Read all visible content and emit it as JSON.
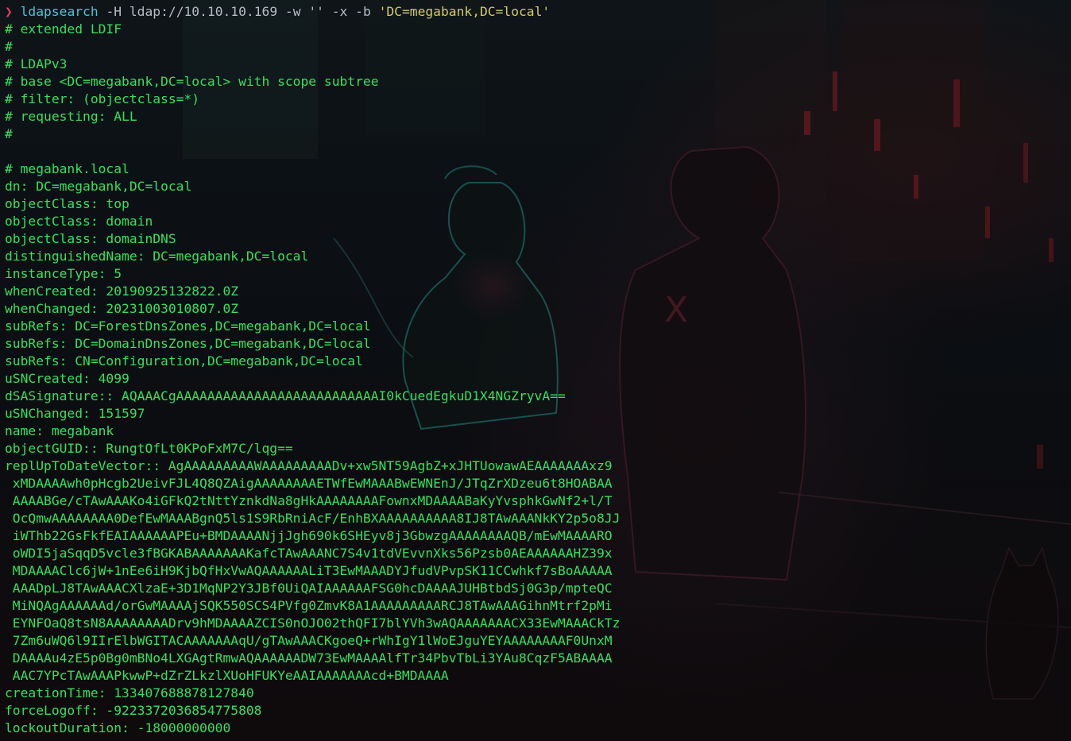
{
  "colors": {
    "text": "#35e05e",
    "prompt_arrow": "#e0405a",
    "command": "#4ec3d8",
    "args": "#b7bcc2",
    "quoted_string": "#d4c96a",
    "background": "#0b0d10"
  },
  "prompt": {
    "arrow": "❯",
    "command": "ldapsearch",
    "args": "-H ldap://10.10.10.169 -w '' -x -b",
    "base_dn": "'DC=megabank,DC=local'"
  },
  "output_lines": [
    "# extended LDIF",
    "#",
    "# LDAPv3",
    "# base <DC=megabank,DC=local> with scope subtree",
    "# filter: (objectclass=*)",
    "# requesting: ALL",
    "#",
    "",
    "# megabank.local",
    "dn: DC=megabank,DC=local",
    "objectClass: top",
    "objectClass: domain",
    "objectClass: domainDNS",
    "distinguishedName: DC=megabank,DC=local",
    "instanceType: 5",
    "whenCreated: 20190925132822.0Z",
    "whenChanged: 20231003010807.0Z",
    "subRefs: DC=ForestDnsZones,DC=megabank,DC=local",
    "subRefs: DC=DomainDnsZones,DC=megabank,DC=local",
    "subRefs: CN=Configuration,DC=megabank,DC=local",
    "uSNCreated: 4099",
    "dSASignature:: AQAAACgAAAAAAAAAAAAAAAAAAAAAAAAAAI0kCuedEgkuD1X4NGZryvA==",
    "uSNChanged: 151597",
    "name: megabank",
    "objectGUID:: RungtOfLt0KPoFxM7C/lqg==",
    "replUpToDateVector:: AgAAAAAAAAAWAAAAAAAAADv+xw5NT59AgbZ+xJHTUowawAEAAAAAAAxz9",
    " xMDAAAAwh0pHcgb2UeivFJL4Q8QZAigAAAAAAAAETWfEwMAAABwEWNEnJ/JTqZrXDzeu6t8HOABAA",
    " AAAABGe/cTAwAAAKo4iGFkQ2tNttYznkdNa8gHkAAAAAAAAFownxMDAAAABaKyYvsphkGwNf2+l/T",
    " OcQmwAAAAAAAA0DefEwMAAABgnQ5ls1S9RbRniAcF/EnhBXAAAAAAAAAA8IJ8TAwAAANkKY2p5o8JJ",
    " iWThb22GsFkfEAIAAAAAAPEu+BMDAAAANjjJgh690k6SHEyv8j3GbwzgAAAAAAAAQB/mEwMAAAARO",
    " oWDI5jaSqqD5vcle3fBGKABAAAAAAAKafcTAwAAANC7S4v1tdVEvvnXks56Pzsb0AEAAAAAAHZ39x",
    " MDAAAAClc6jW+1nEe6iH9KjbQfHxVwAQAAAAAALiT3EwMAAADYJfudVPvpSK11CCwhkf7sBoAAAAA",
    " AAADpLJ8TAwAAACXlzaE+3D1MqNP2Y3JBf0UiQAIAAAAAAFSG0hcDAAAAJUHBtbdSj0G3p/mpteQC",
    " MiNQAgAAAAAAd/orGwMAAAAjSQK550SCS4PVfg0ZmvK8A1AAAAAAAAARCJ8TAwAAAGihnMtrf2pMi",
    " EYNFOaQ8tsN8AAAAAAAADrv9hMDAAAAZCIS0nOJO02thQFI7blYVh3wAQAAAAAAACX33EwMAAACkTz",
    " 7Zm6uWQ6l9IIrElbWGITACAAAAAAAqU/gTAwAAACKgoeQ+rWhIgY1lWoEJguYEYAAAAAAAAF0UnxM",
    " DAAAAu4zE5p0Bg0mBNo4LXGAgtRmwAQAAAAAADW73EwMAAAAlfTr34PbvTbLi3YAu8CqzF5ABAAAA",
    " AAC7YPcTAwAAAPkwwP+dZrZLkzlXUoHFUKYeAAIAAAAAAAcd+BMDAAAA",
    "creationTime: 133407688878127840",
    "forceLogoff: -9223372036854775808",
    "lockoutDuration: -18000000000"
  ]
}
